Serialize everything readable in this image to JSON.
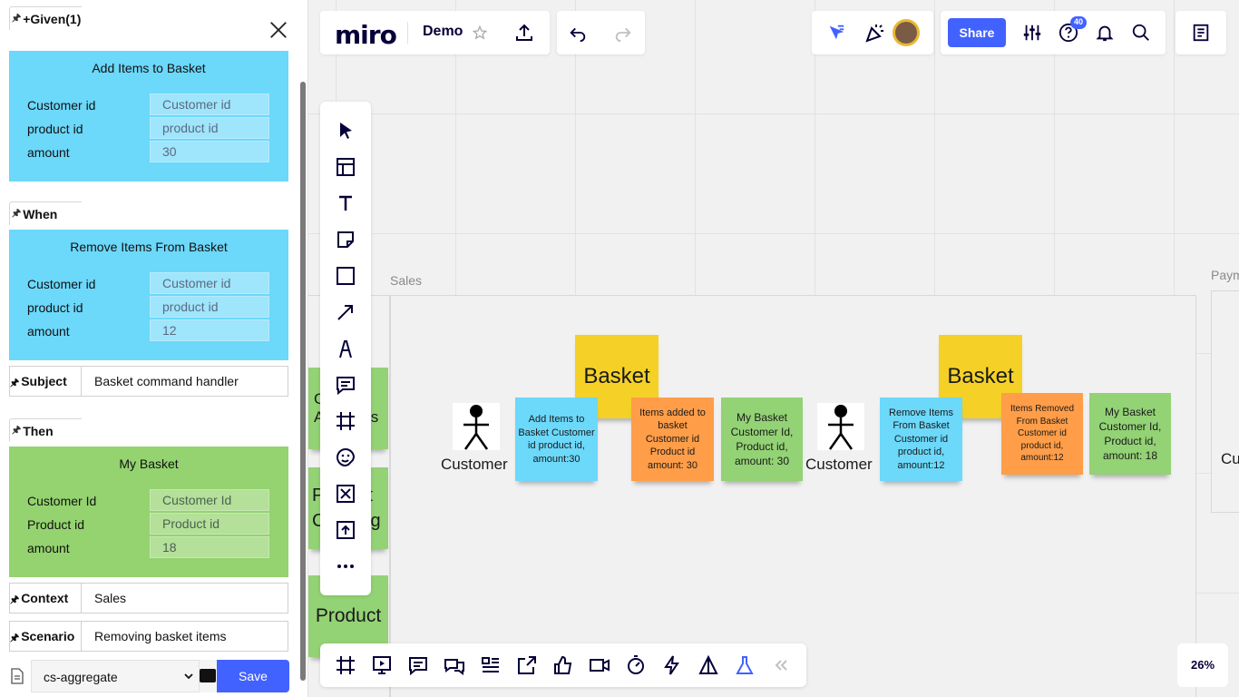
{
  "panel": {
    "given_label": "+Given(1)",
    "when_label": "When",
    "subject_label": "Subject",
    "then_label": "Then",
    "context_label": "Context",
    "scenario_label": "Scenario",
    "given_card": {
      "title": "Add Items to Basket",
      "fields": [
        {
          "label": "Customer id",
          "placeholder": "Customer id",
          "value": ""
        },
        {
          "label": "product id",
          "placeholder": "product id",
          "value": ""
        },
        {
          "label": "amount",
          "placeholder": "",
          "value": "30"
        }
      ]
    },
    "when_card": {
      "title": "Remove Items From Basket",
      "fields": [
        {
          "label": "Customer id",
          "placeholder": "Customer id",
          "value": ""
        },
        {
          "label": "product id",
          "placeholder": "product id",
          "value": ""
        },
        {
          "label": "amount",
          "placeholder": "",
          "value": "12"
        }
      ]
    },
    "subject_value": "Basket command handler",
    "then_card": {
      "title": "My Basket",
      "fields": [
        {
          "label": "Customer Id",
          "placeholder": "Customer Id",
          "value": ""
        },
        {
          "label": "Product id",
          "placeholder": "Product id",
          "value": ""
        },
        {
          "label": "amount",
          "placeholder": "",
          "value": "18"
        }
      ]
    },
    "context_value": "Sales",
    "scenario_value": "Removing basket items",
    "select_value": "cs-aggregate",
    "save_label": "Save"
  },
  "topbar": {
    "logo": "miro",
    "board_name": "Demo",
    "share_label": "Share",
    "notifications_badge": "40"
  },
  "zoom_level": "26%",
  "frames": {
    "sales_label": "Sales",
    "payments_label_partial": "Paym"
  },
  "board": {
    "stickies": [
      {
        "id": "basket1",
        "text": "Basket",
        "color": "yellow"
      },
      {
        "id": "add-items",
        "text": "Add Items to Basket Customer id product id, amount:30",
        "color": "blue"
      },
      {
        "id": "items-added",
        "text": "Items added to basket Customer id Product id amount: 30",
        "color": "orange"
      },
      {
        "id": "my-basket1",
        "text": "My Basket Customer Id, Product id, amount: 30",
        "color": "green"
      },
      {
        "id": "basket2",
        "text": "Basket",
        "color": "yellow"
      },
      {
        "id": "remove-items",
        "text": "Remove Items From Basket Customer id product id, amount:12",
        "color": "blue"
      },
      {
        "id": "items-removed",
        "text": "Items Removed From Basket Customer id product id, amount:12",
        "color": "orange"
      },
      {
        "id": "my-basket2",
        "text": "My Basket Customer Id, Product id, amount: 18",
        "color": "green"
      }
    ],
    "actors": [
      "Customer",
      "Customer"
    ],
    "left_partial": {
      "sticky1_line1": "C",
      "sticky1_line1b": "er",
      "sticky1_line2": "A",
      "sticky1_line2b": "es",
      "sticky2_line1": "P",
      "sticky2_line1b": "ct",
      "sticky2_line2": "C",
      "sticky2_line2b": "g",
      "sticky3": "Product"
    },
    "right_partial": "Cu"
  },
  "colors": {
    "accent": "#4262ff",
    "command_blue": "#6cd8fa",
    "event_orange": "#ff9d48",
    "readmodel_green": "#93d275",
    "aggregate_yellow": "#f5d128"
  }
}
